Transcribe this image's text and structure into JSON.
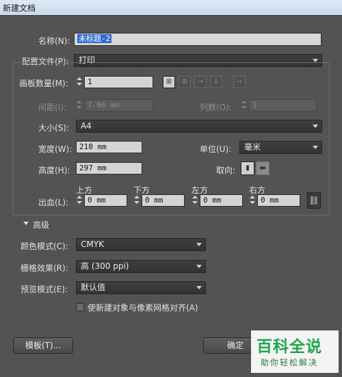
{
  "window": {
    "title": "新建文档"
  },
  "name": {
    "label": "名称(N):",
    "value": "未标题-2"
  },
  "profile": {
    "label": "配置文件(P):",
    "value": "打印"
  },
  "artboards": {
    "label": "画板数量(M):",
    "value": "1"
  },
  "spacing": {
    "label": "间距(I):",
    "value": "7.06 mm"
  },
  "columns": {
    "label": "列数(O):",
    "value": "1"
  },
  "size": {
    "label": "大小(S):",
    "value": "A4"
  },
  "width": {
    "label": "宽度(W):",
    "value": "210 mm"
  },
  "units": {
    "label": "单位(U):",
    "value": "毫米"
  },
  "height": {
    "label": "高度(H):",
    "value": "297 mm"
  },
  "orientation": {
    "label": "取向:"
  },
  "bleed": {
    "label": "出血(L):",
    "top": {
      "label": "上方",
      "value": "0 mm"
    },
    "bottom": {
      "label": "下方",
      "value": "0 mm"
    },
    "left": {
      "label": "左方",
      "value": "0 mm"
    },
    "right": {
      "label": "右方",
      "value": "0 mm"
    }
  },
  "advanced": {
    "label": "高级"
  },
  "color_mode": {
    "label": "颜色模式(C):",
    "value": "CMYK"
  },
  "raster": {
    "label": "栅格效果(R):",
    "value": "高 (300 ppi)"
  },
  "preview": {
    "label": "预览模式(E):",
    "value": "默认值"
  },
  "align_pixel": {
    "label": "使新建对象与像素网格对齐(A)",
    "checked": false
  },
  "buttons": {
    "templates": "模板(T)...",
    "ok": "确定"
  },
  "watermark": {
    "title": "百科全说",
    "subtitle": "助你轻松解决"
  }
}
